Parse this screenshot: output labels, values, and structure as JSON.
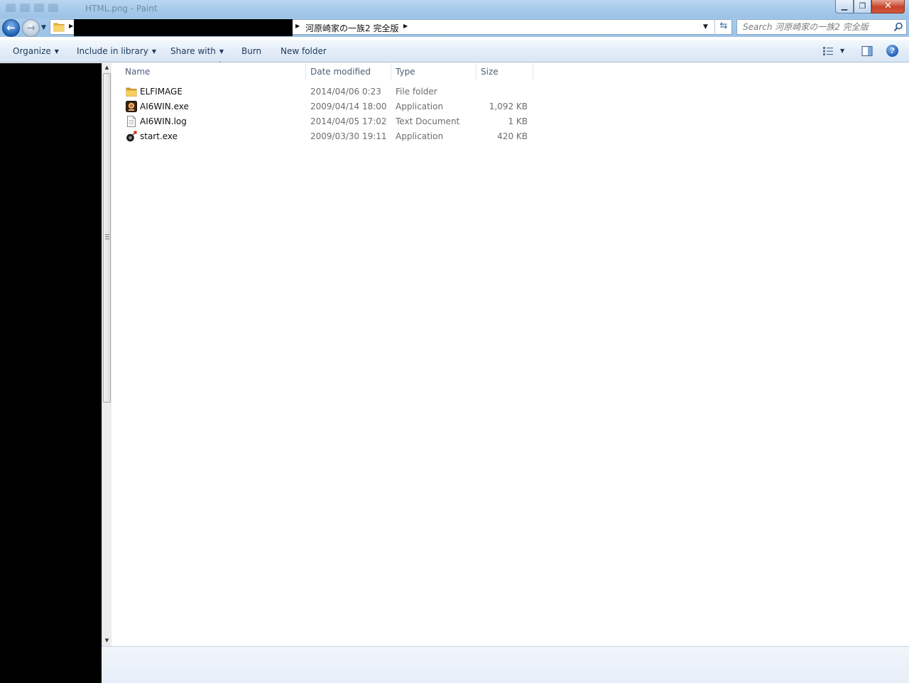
{
  "window": {
    "title": "HTML.png - Paint",
    "controls": {
      "minimize": "▁",
      "maximize": "❐",
      "close": "✕"
    }
  },
  "nav": {
    "back_icon": "back-arrow-icon",
    "forward_icon": "forward-arrow-icon",
    "address": {
      "crumb": "河原崎家の一族2 完全版",
      "separator": "▶"
    },
    "search": {
      "placeholder": "Search 河原崎家の一族2 完全版"
    }
  },
  "toolbar": {
    "organize": "Organize",
    "include_in_library": "Include in library",
    "share_with": "Share with",
    "burn": "Burn",
    "new_folder": "New folder",
    "caret": "▼"
  },
  "columns": {
    "name": "Name",
    "date": "Date modified",
    "type": "Type",
    "size": "Size"
  },
  "files": [
    {
      "name": "ELFIMAGE",
      "date": "2014/04/06 0:23",
      "type": "File folder",
      "size": "",
      "icon": "folder-icon"
    },
    {
      "name": "AI6WIN.exe",
      "date": "2009/04/14 18:00",
      "type": "Application",
      "size": "1,092 KB",
      "icon": "ai6win-app-icon"
    },
    {
      "name": "AI6WIN.log",
      "date": "2014/04/05 17:02",
      "type": "Text Document",
      "size": "1 KB",
      "icon": "text-document-icon"
    },
    {
      "name": "start.exe",
      "date": "2009/03/30 19:11",
      "type": "Application",
      "size": "420 KB",
      "icon": "start-app-icon"
    }
  ],
  "colors": {
    "titlebar": "#a6c9ea",
    "toolbar_text": "#1e395b",
    "redaction": "#000000"
  }
}
